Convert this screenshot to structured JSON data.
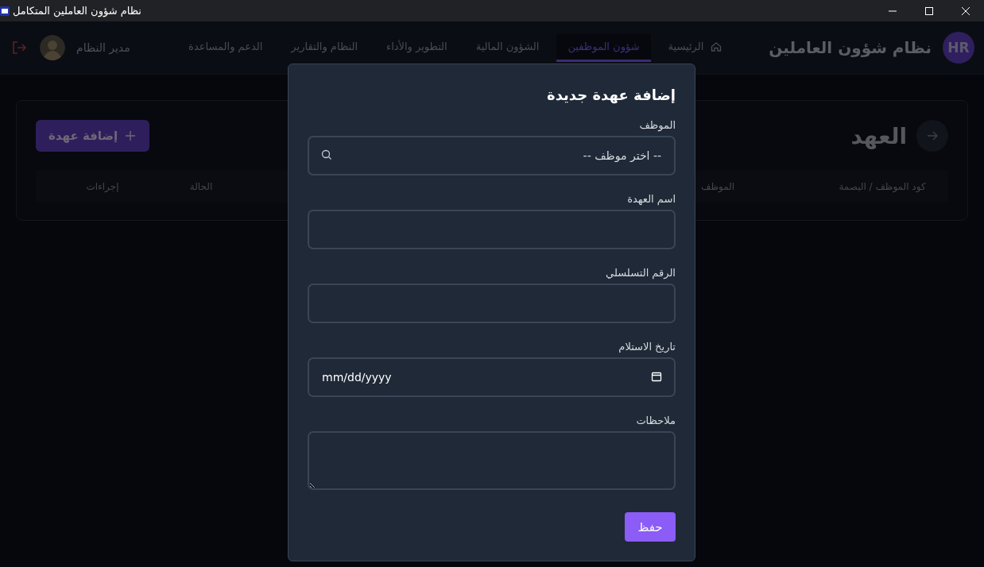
{
  "window": {
    "title": "نظام شؤون العاملين المتكامل"
  },
  "app": {
    "logo": "HR",
    "title": "نظام شؤون العاملين"
  },
  "nav_tabs": [
    {
      "label": "الرئيسية",
      "kind": "home",
      "selected": false
    },
    {
      "label": "شؤون الموظفين",
      "selected": true
    },
    {
      "label": "الشؤون المالية",
      "selected": false
    },
    {
      "label": "التطوير والأداء",
      "selected": false
    },
    {
      "label": "النظام والتقارير",
      "selected": false
    },
    {
      "label": "الدعم والمساعدة",
      "selected": false
    }
  ],
  "user": {
    "name": "مدير النظام"
  },
  "page": {
    "title": "العهد",
    "add_button": "إضافة عهدة"
  },
  "table": {
    "columns": [
      "كود الموظف / البصمة",
      "الموظف",
      "الحالة",
      "إجراءات"
    ]
  },
  "modal": {
    "title": "إضافة عهدة جديدة",
    "fields": [
      {
        "kind": "select",
        "label": "الموظف",
        "placeholder": "-- اختر موظف --"
      },
      {
        "kind": "text",
        "label": "اسم العهدة"
      },
      {
        "kind": "text",
        "label": "الرقم التسلسلي"
      },
      {
        "kind": "date",
        "label": "تاريخ الاستلام",
        "placeholder": "mm/dd/yyyy"
      },
      {
        "kind": "textarea",
        "label": "ملاحظات"
      }
    ],
    "save_button": "حفظ"
  }
}
